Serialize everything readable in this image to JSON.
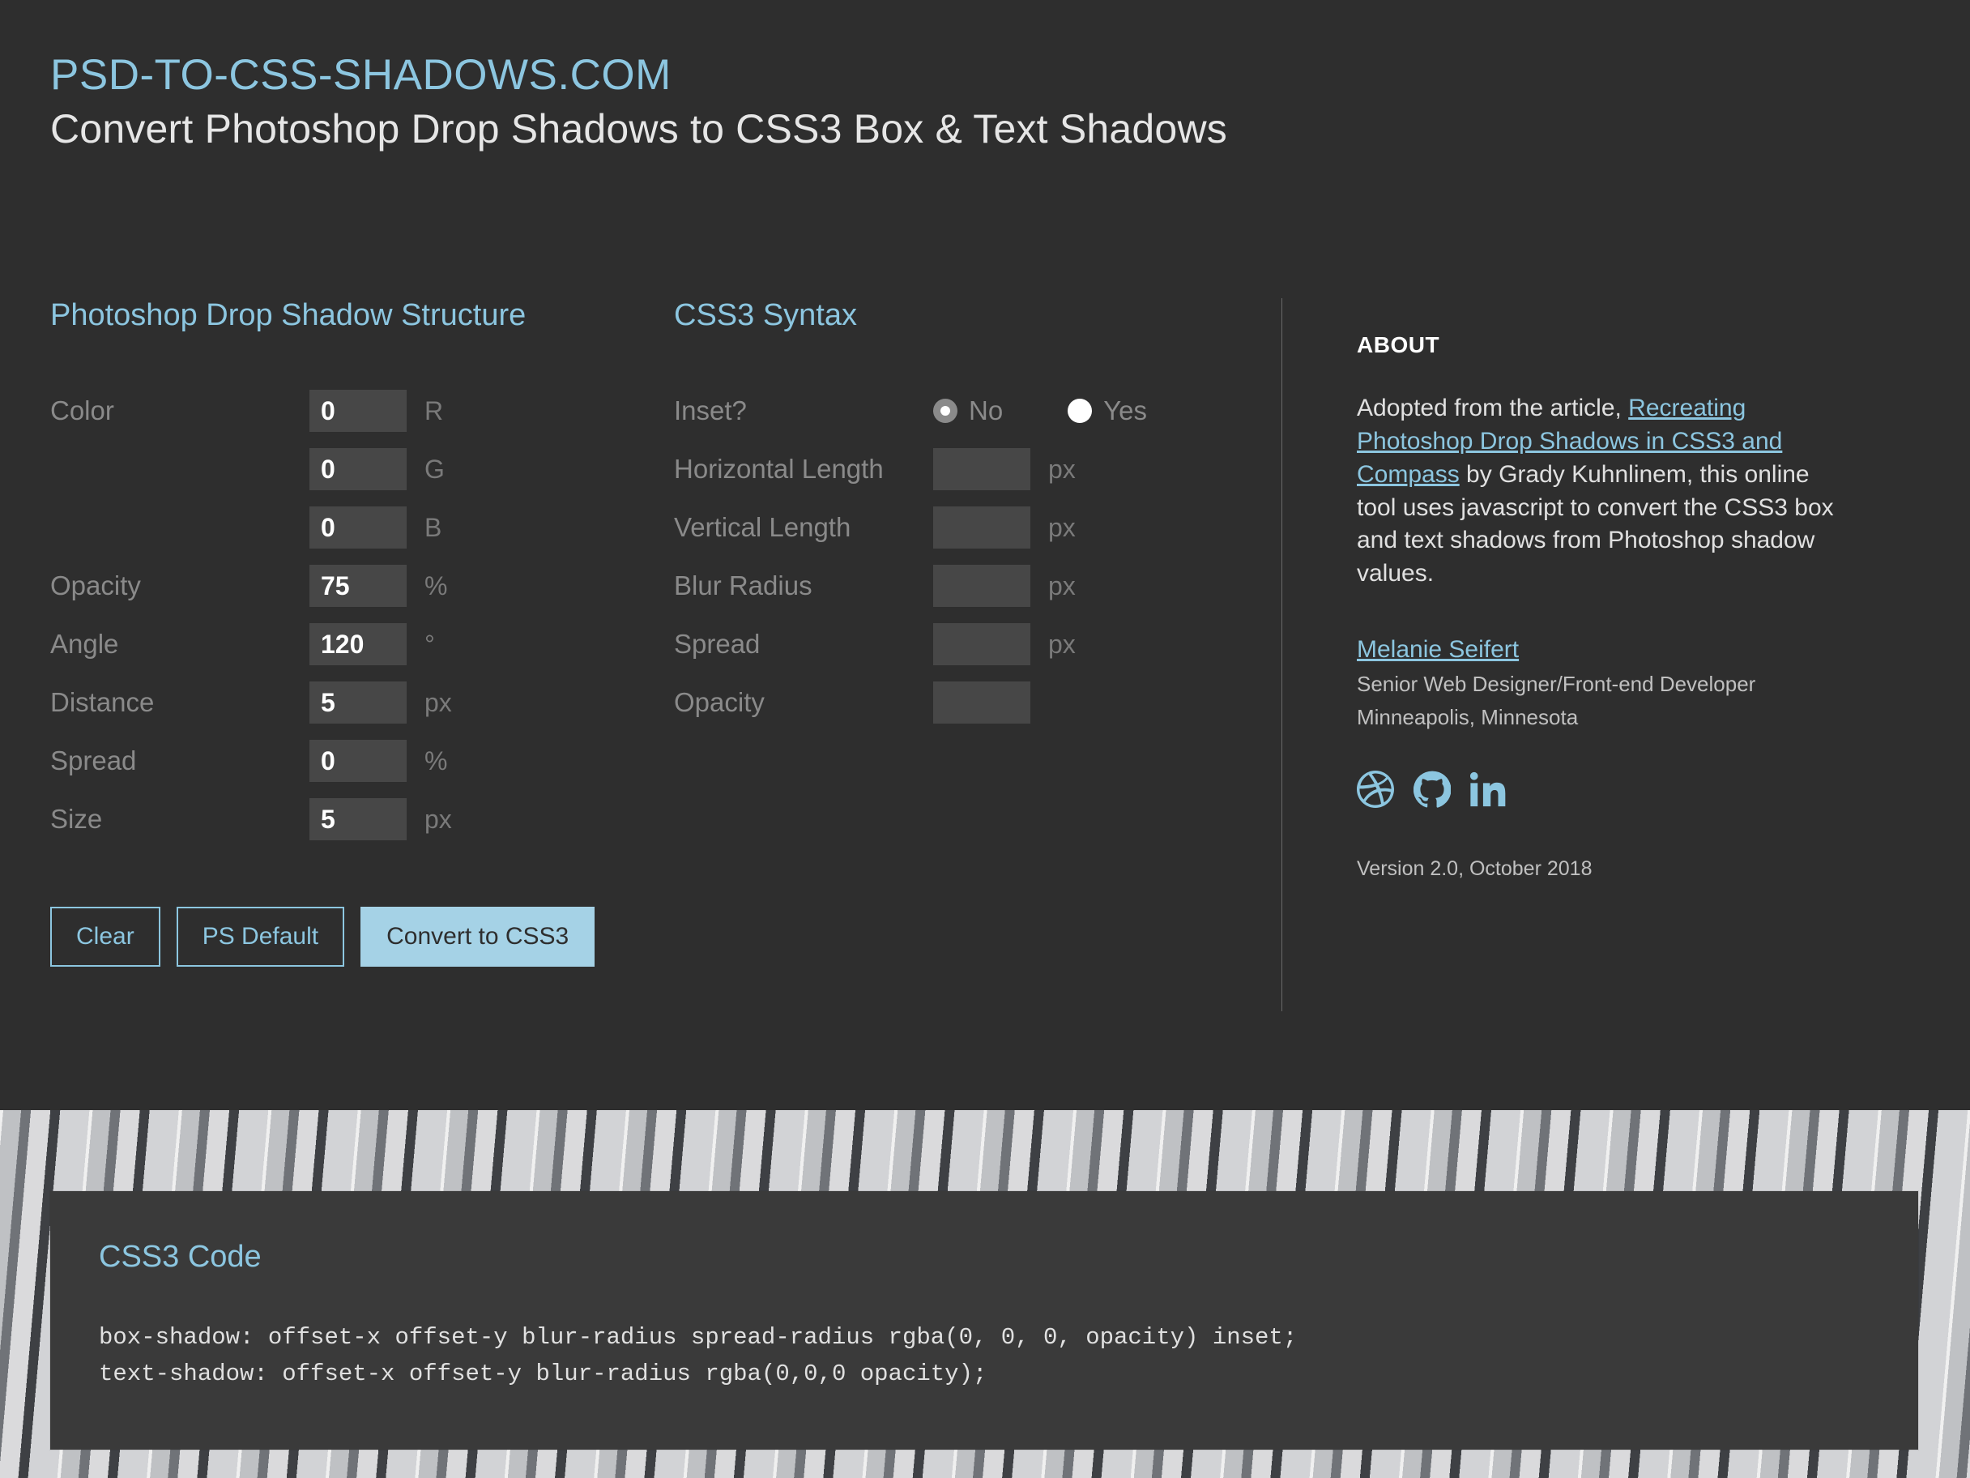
{
  "header": {
    "title": "PSD-TO-CSS-SHADOWS.COM",
    "subtitle": "Convert Photoshop Drop Shadows to CSS3 Box & Text Shadows"
  },
  "ps": {
    "heading": "Photoshop Drop Shadow Structure",
    "fields": {
      "color": {
        "label": "Color",
        "r": "0",
        "g": "0",
        "b": "0",
        "r_unit": "R",
        "g_unit": "G",
        "b_unit": "B"
      },
      "opacity": {
        "label": "Opacity",
        "value": "75",
        "unit": "%"
      },
      "angle": {
        "label": "Angle",
        "value": "120",
        "unit": "°"
      },
      "distance": {
        "label": "Distance",
        "value": "5",
        "unit": "px"
      },
      "spread": {
        "label": "Spread",
        "value": "0",
        "unit": "%"
      },
      "size": {
        "label": "Size",
        "value": "5",
        "unit": "px"
      }
    },
    "buttons": {
      "clear": "Clear",
      "default": "PS Default",
      "convert": "Convert to CSS3"
    }
  },
  "css3": {
    "heading": "CSS3 Syntax",
    "inset": {
      "label": "Inset?",
      "no": "No",
      "yes": "Yes",
      "selected": "no"
    },
    "fields": {
      "hlen": {
        "label": "Horizontal Length",
        "value": "",
        "unit": "px"
      },
      "vlen": {
        "label": "Vertical Length",
        "value": "",
        "unit": "px"
      },
      "blur": {
        "label": "Blur Radius",
        "value": "",
        "unit": "px"
      },
      "spread": {
        "label": "Spread",
        "value": "",
        "unit": "px"
      },
      "opacity": {
        "label": "Opacity",
        "value": "",
        "unit": ""
      }
    }
  },
  "about": {
    "heading": "ABOUT",
    "text_pre": "Adopted from the article, ",
    "link_text": "Recreating Photoshop Drop Shadows in CSS3 and Compass",
    "text_post": " by Grady Kuhnlinem, this online tool uses javascript to convert the CSS3 box and text shadows from Photoshop shadow values.",
    "name": "Melanie Seifert",
    "role": "Senior Web Designer/Front-end Developer",
    "location": "Minneapolis, Minnesota",
    "version": "Version 2.0, October 2018"
  },
  "code": {
    "heading": "CSS3 Code",
    "line1": "box-shadow: offset-x offset-y blur-radius spread-radius rgba(0, 0, 0, opacity) inset;",
    "line2": "text-shadow: offset-x offset-y blur-radius rgba(0,0,0 opacity);"
  }
}
